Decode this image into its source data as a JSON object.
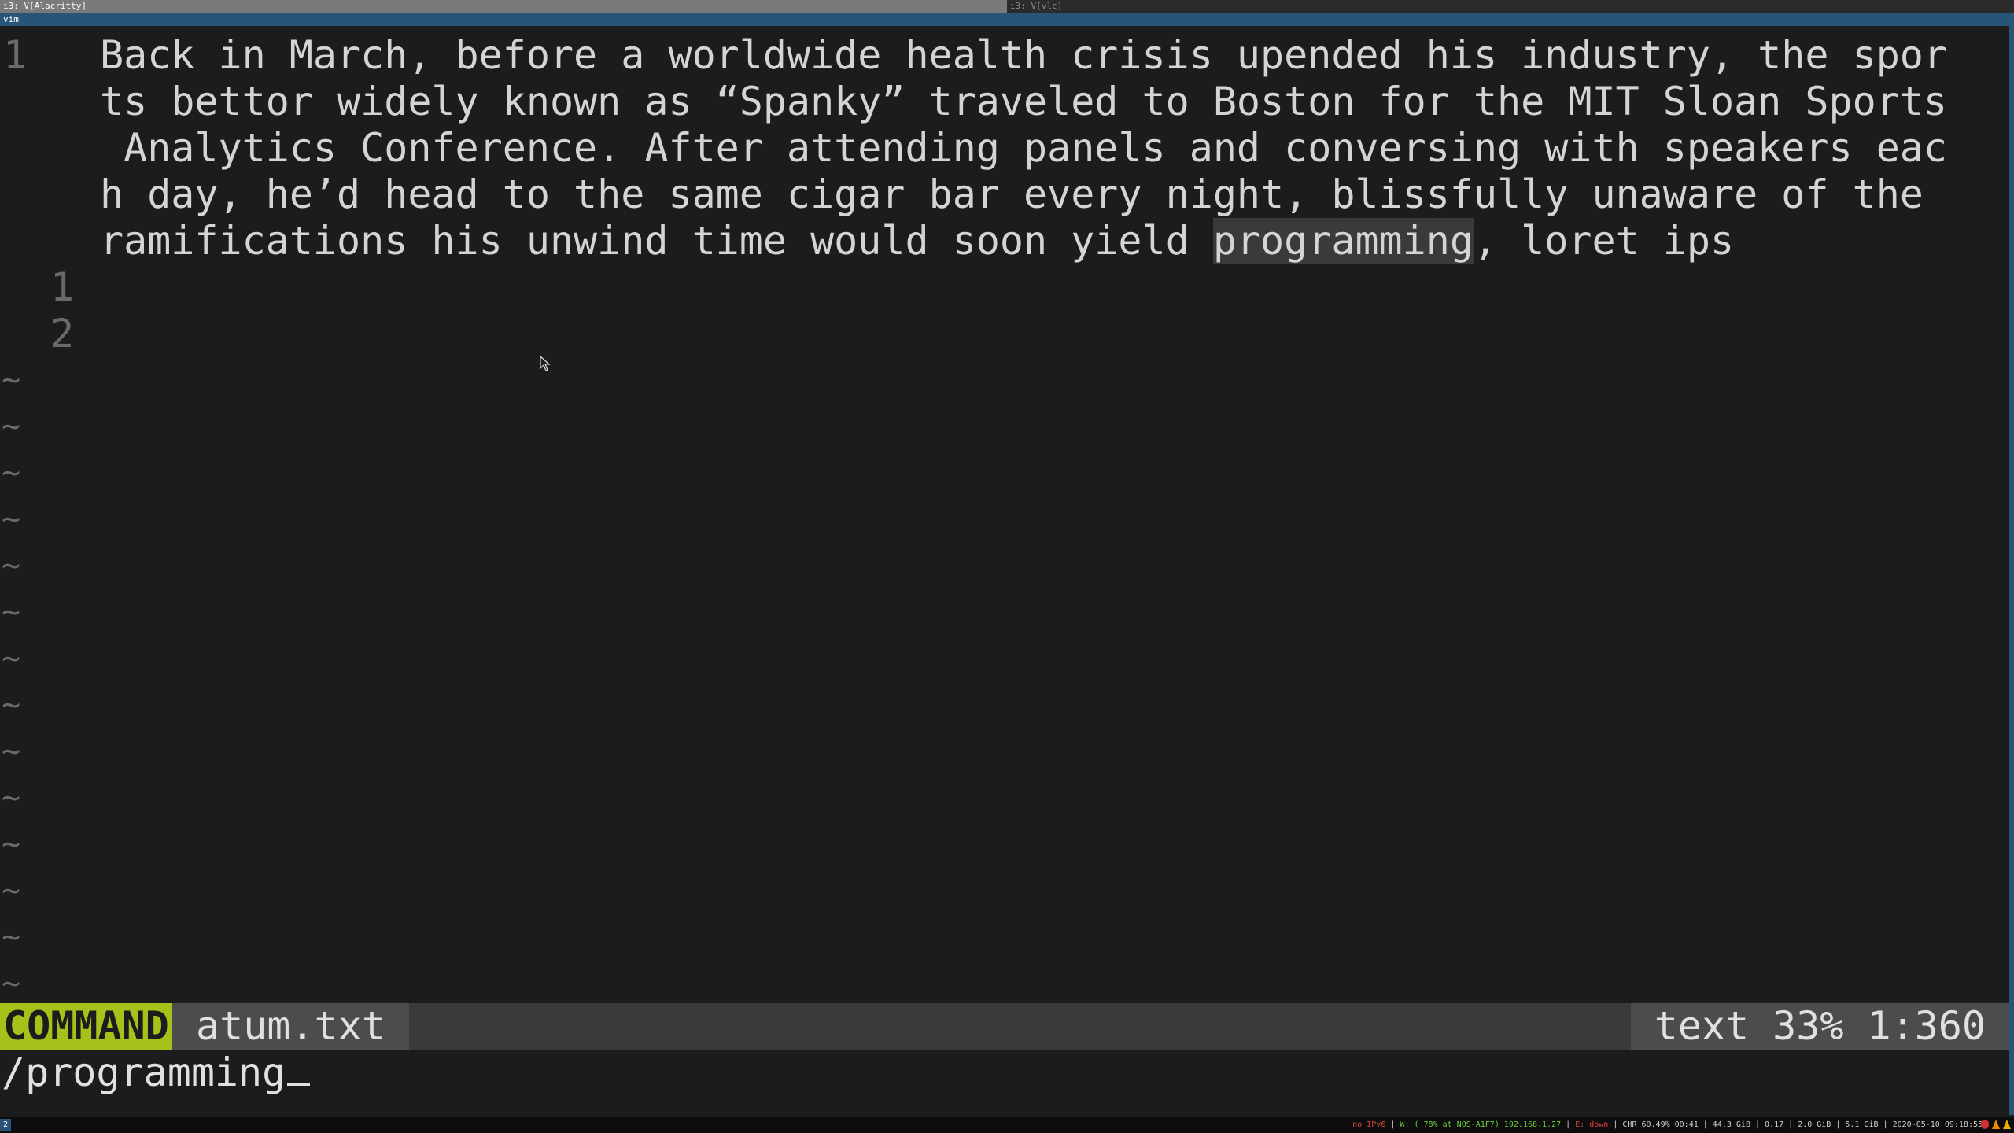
{
  "window": {
    "tab_active": "i3: V[Alacritty]",
    "tab_inactive": "i3: V[vlc]",
    "title": "vim"
  },
  "editor": {
    "line_number_main": "1",
    "text_lines": [
      "Back in March, before a worldwide health crisis upended his industry, the spor",
      "ts bettor widely known as “Spanky” traveled to Boston for the MIT Sloan Sports",
      " Analytics Conference. After attending panels and conversing with speakers eac",
      "h day, he’d head to the same cigar bar every night, blissfully unaware of the"
    ],
    "last_line_before": "ramifications his unwind time would soon yield ",
    "search_match": "programming",
    "last_line_after": ", loret ips",
    "relative_numbers": [
      "1",
      "2"
    ],
    "tilde": "~"
  },
  "statusline": {
    "mode": "COMMAND",
    "file": "atum.txt",
    "filetype": "text",
    "percent": "33%",
    "position": "1:360"
  },
  "cmdline": {
    "text": "/programming"
  },
  "i3bar": {
    "workspace": "2",
    "ipv6": "no IPv6",
    "wifi": "W: ( 78% at NOS-A1F7) 192.168.1.27",
    "eth": "E: down",
    "battery": "CHR 60.49% 00:41",
    "disk": "44.3 GiB",
    "load": "0.17",
    "memory": "2.0 GiB | 5.1 GiB",
    "datetime": "2020-05-10 09:18:55"
  },
  "colors": {
    "mode_badge": "#a6c21a",
    "focused_border": "#285577",
    "background": "#1c1c1c"
  }
}
